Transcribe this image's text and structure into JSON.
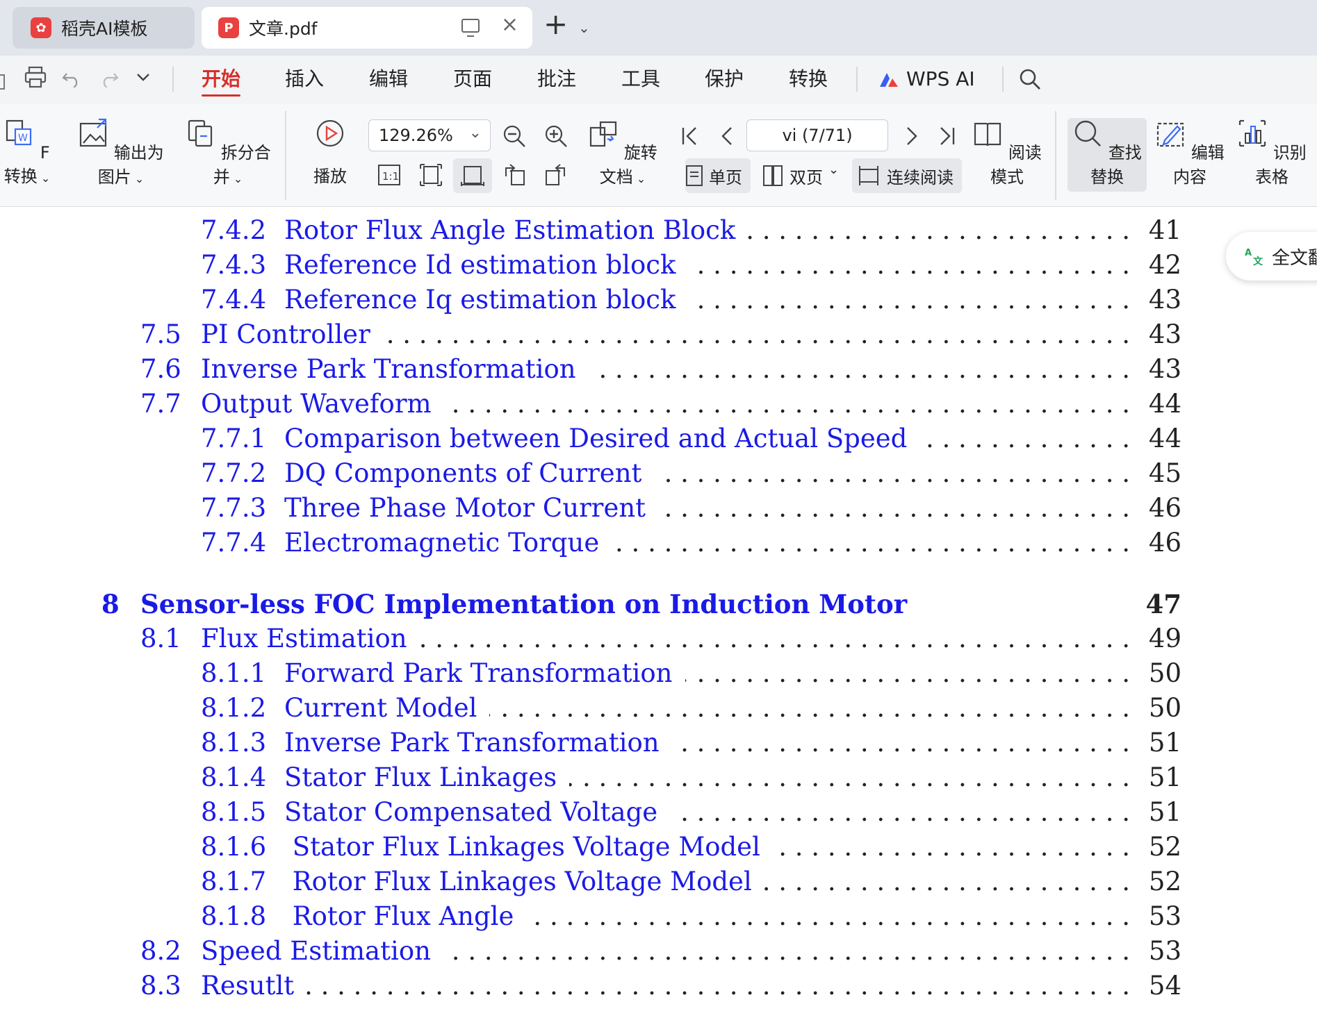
{
  "tabs": [
    {
      "label": "稻壳AI模板",
      "active": false
    },
    {
      "label": "文章.pdf",
      "active": true
    }
  ],
  "menu": {
    "items": [
      "开始",
      "插入",
      "编辑",
      "页面",
      "批注",
      "工具",
      "保护",
      "转换"
    ],
    "active": "开始",
    "ai_label": "WPS AI"
  },
  "toolbar": {
    "pdf_convert": "F转换",
    "export_image": "输出为图片",
    "split_merge": "拆分合并",
    "play": "播放",
    "zoom_value": "129.26%",
    "rotate_doc": "旋转文档",
    "page_value": "vi (7/71)",
    "single_page": "单页",
    "double_page": "双页",
    "continuous_read": "连续阅读",
    "read_mode": "阅读模式",
    "find_replace": "查找替换",
    "edit_content": "编辑内容",
    "recognize_table": "识别表格"
  },
  "translate_pill": "全文翻",
  "toc": [
    {
      "num": "7.4.2",
      "title": "Rotor Flux Angle Estimation Block",
      "page": "41",
      "level": 3
    },
    {
      "num": "7.4.3",
      "title": "Reference Id estimation block",
      "page": "42",
      "level": 3
    },
    {
      "num": "7.4.4",
      "title": "Reference Iq estimation block",
      "page": "43",
      "level": 3
    },
    {
      "num": "7.5",
      "title": "PI Controller",
      "page": "43",
      "level": 2
    },
    {
      "num": "7.6",
      "title": "Inverse Park Transformation",
      "page": "43",
      "level": 2
    },
    {
      "num": "7.7",
      "title": "Output Waveform",
      "page": "44",
      "level": 2
    },
    {
      "num": "7.7.1",
      "title": "Comparison between Desired and Actual Speed",
      "page": "44",
      "level": 3
    },
    {
      "num": "7.7.2",
      "title": "DQ Components of Current",
      "page": "45",
      "level": 3
    },
    {
      "num": "7.7.3",
      "title": "Three Phase Motor Current",
      "page": "46",
      "level": 3
    },
    {
      "num": "7.7.4",
      "title": "Electromagnetic Torque",
      "page": "46",
      "level": 3
    },
    {
      "num": "8",
      "title": "Sensor-less FOC Implementation on Induction Motor",
      "page": "47",
      "level": 1
    },
    {
      "num": "8.1",
      "title": "Flux Estimation",
      "page": "49",
      "level": 2
    },
    {
      "num": "8.1.1",
      "title": "Forward Park Transformation",
      "page": "50",
      "level": 3
    },
    {
      "num": "8.1.2",
      "title": "Current Model",
      "page": "50",
      "level": 3
    },
    {
      "num": "8.1.3",
      "title": "Inverse Park Transformation",
      "page": "51",
      "level": 3
    },
    {
      "num": "8.1.4",
      "title": "Stator Flux Linkages",
      "page": "51",
      "level": 3
    },
    {
      "num": "8.1.5",
      "title": "Stator Compensated Voltage",
      "page": "51",
      "level": 3
    },
    {
      "num": "8.1.6",
      "title": " Stator Flux Linkages Voltage Model",
      "page": "52",
      "level": 3
    },
    {
      "num": "8.1.7",
      "title": " Rotor Flux Linkages Voltage Model",
      "page": "52",
      "level": 3
    },
    {
      "num": "8.1.8",
      "title": " Rotor Flux Angle",
      "page": "53",
      "level": 3
    },
    {
      "num": "8.2",
      "title": "Speed Estimation",
      "page": "53",
      "level": 2
    },
    {
      "num": "8.3",
      "title": "Resutlt",
      "page": "54",
      "level": 2
    }
  ]
}
